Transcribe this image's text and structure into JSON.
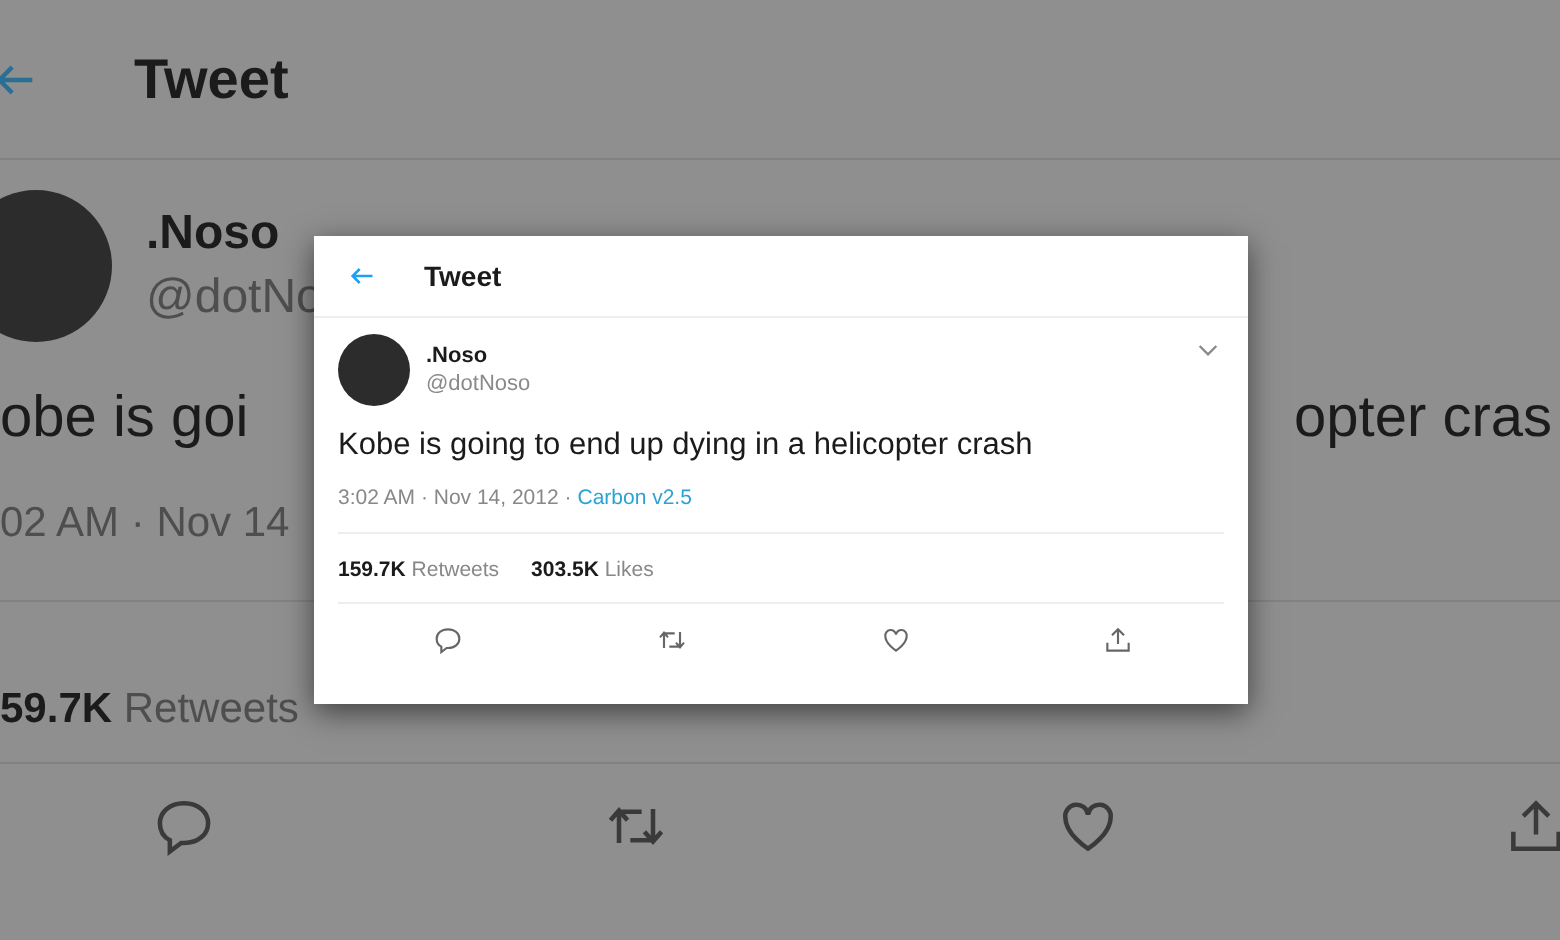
{
  "background": {
    "header": {
      "title": "Tweet"
    },
    "author": {
      "name": ".Noso",
      "handle": "@dotNo"
    },
    "tweet_text": [
      "obe is goi",
      "opter cras"
    ],
    "timestamp": "02 AM · Nov 14",
    "stats": [
      {
        "count": "59.7K",
        "label": "Retweets"
      }
    ]
  },
  "tweet_card": {
    "header": {
      "title": "Tweet"
    },
    "author": {
      "name": ".Noso",
      "handle": "@dotNoso"
    },
    "text": "Kobe is going to end up dying in a helicopter crash",
    "timestamp": "3:02 AM · Nov 14, 2012 ·",
    "source": "Carbon v2.5",
    "stats": [
      {
        "count": "159.7K",
        "label": "Retweets"
      },
      {
        "count": "303.5K",
        "label": "Likes"
      }
    ]
  }
}
